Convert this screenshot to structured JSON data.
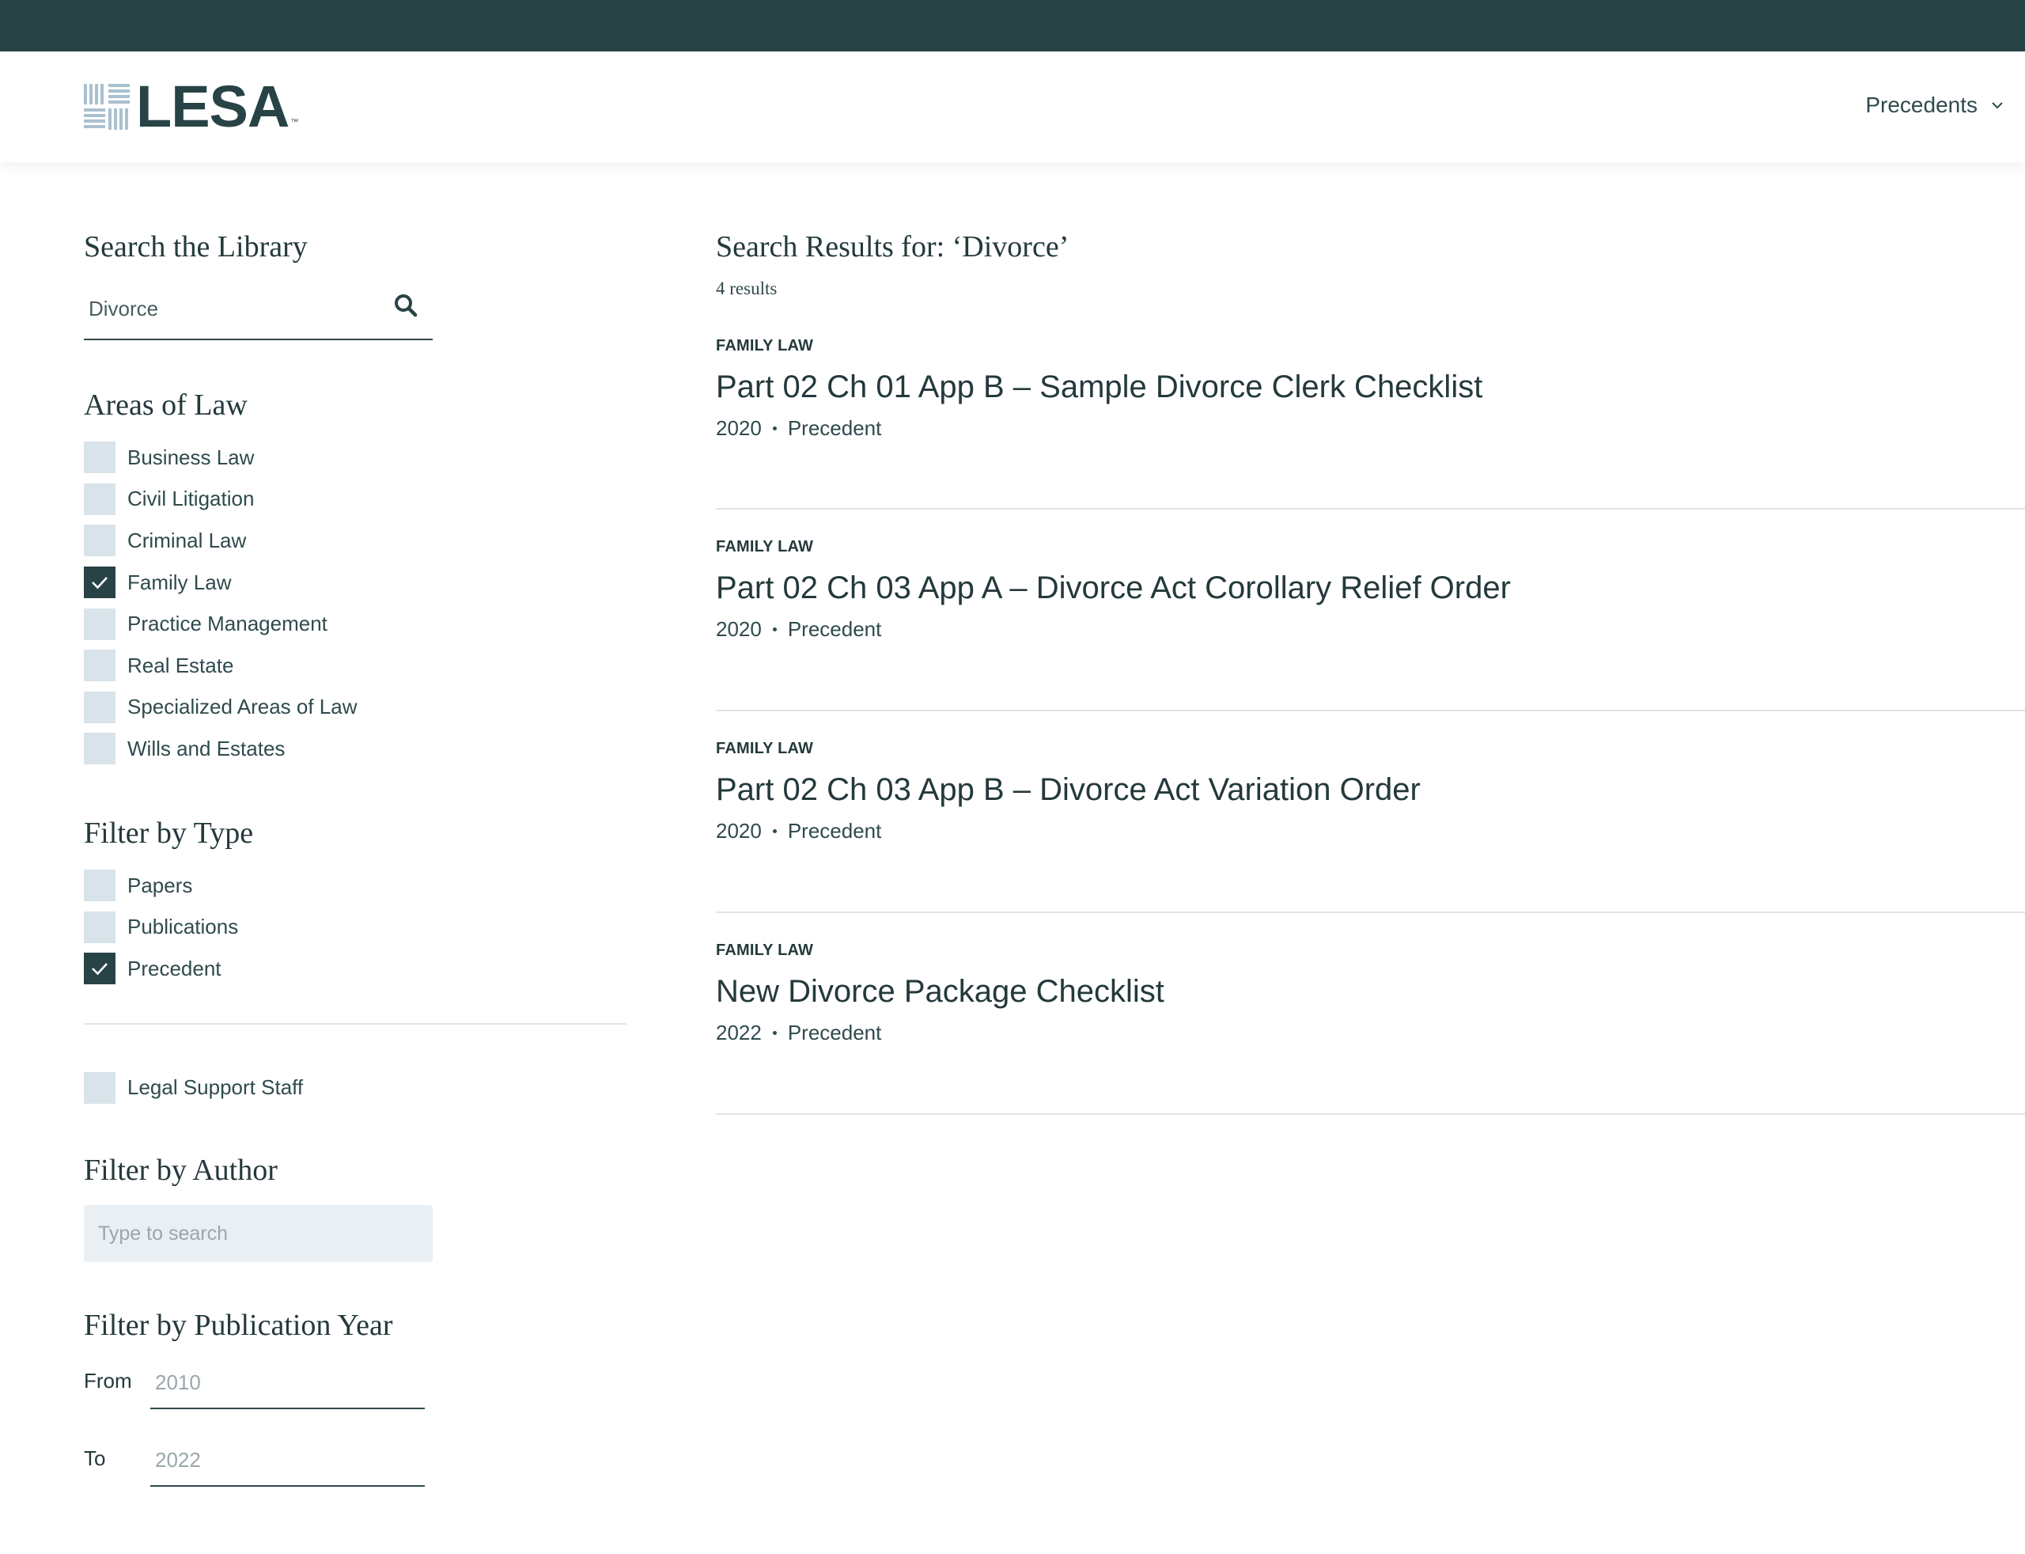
{
  "brand": {
    "name": "LESA",
    "tm": "™"
  },
  "nav": {
    "precedents_label": "Precedents"
  },
  "search": {
    "heading": "Search the Library",
    "value": "Divorce"
  },
  "areas_of_law": {
    "heading": "Areas of Law",
    "items": [
      {
        "label": "Business Law",
        "checked": false
      },
      {
        "label": "Civil Litigation",
        "checked": false
      },
      {
        "label": "Criminal Law",
        "checked": false
      },
      {
        "label": "Family Law",
        "checked": true
      },
      {
        "label": "Practice Management",
        "checked": false
      },
      {
        "label": "Real Estate",
        "checked": false
      },
      {
        "label": "Specialized Areas of Law",
        "checked": false
      },
      {
        "label": "Wills and Estates",
        "checked": false
      }
    ]
  },
  "filter_type": {
    "heading": "Filter by Type",
    "items": [
      {
        "label": "Papers",
        "checked": false
      },
      {
        "label": "Publications",
        "checked": false
      },
      {
        "label": "Precedent",
        "checked": true
      }
    ]
  },
  "legal_support": {
    "label": "Legal Support Staff",
    "checked": false
  },
  "filter_author": {
    "heading": "Filter by Author",
    "placeholder": "Type to search"
  },
  "filter_year": {
    "heading": "Filter by Publication Year",
    "from_label": "From",
    "from_placeholder": "2010",
    "to_label": "To",
    "to_placeholder": "2022"
  },
  "results": {
    "title": "Search Results for: ‘Divorce’",
    "count": "4 results",
    "items": [
      {
        "category": "FAMILY LAW",
        "title": "Part 02 Ch 01 App B – Sample Divorce Clerk Checklist",
        "year": "2020",
        "type": "Precedent"
      },
      {
        "category": "FAMILY LAW",
        "title": "Part 02 Ch 03 App A – Divorce Act Corollary Relief Order",
        "year": "2020",
        "type": "Precedent"
      },
      {
        "category": "FAMILY LAW",
        "title": "Part 02 Ch 03 App B – Divorce Act Variation Order",
        "year": "2020",
        "type": "Precedent"
      },
      {
        "category": "FAMILY LAW",
        "title": "New Divorce Package Checklist",
        "year": "2022",
        "type": "Precedent"
      }
    ]
  },
  "colors": {
    "dark_teal": "#284346",
    "checkbox_bg": "#d8e3ea",
    "logo_mark": "#a9c0cf"
  }
}
